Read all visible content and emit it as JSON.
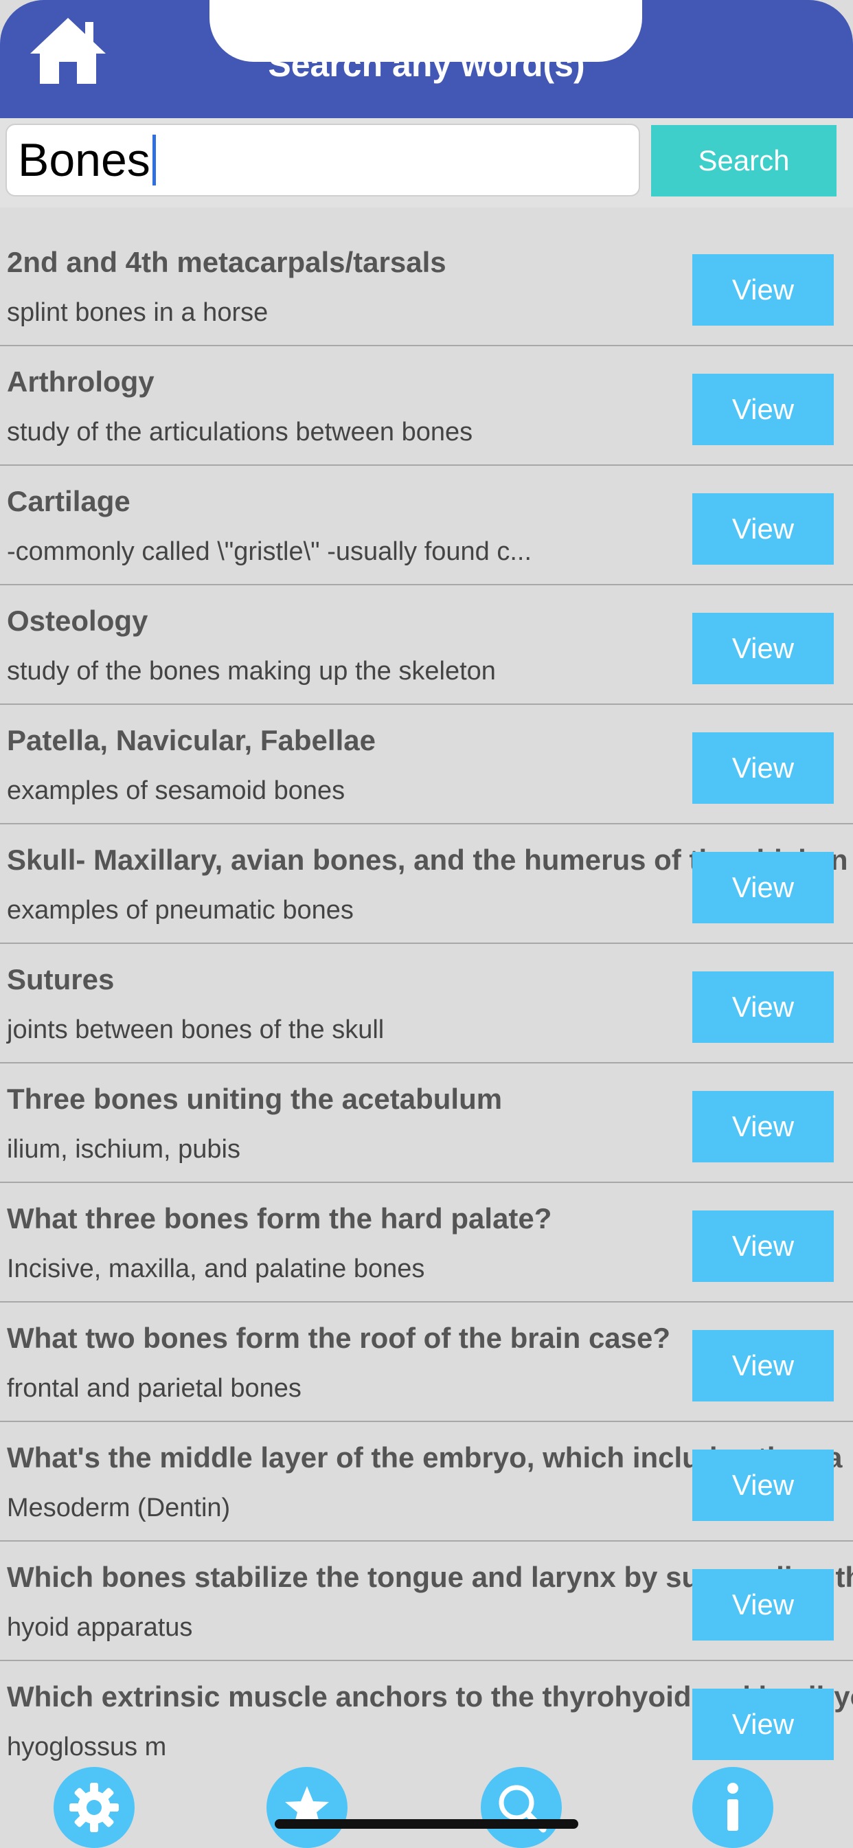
{
  "header": {
    "title": "Search any word(s)"
  },
  "search": {
    "value": "Bones",
    "button_label": "Search"
  },
  "results": [
    {
      "term": "2nd and 4th metacarpals/tarsals",
      "definition": "splint bones in a horse",
      "button": "View"
    },
    {
      "term": "Arthrology",
      "definition": "study of the articulations between bones",
      "button": "View"
    },
    {
      "term": "Cartilage",
      "definition": "-commonly called \\\"gristle\\\" -usually found c...",
      "button": "View"
    },
    {
      "term": "Osteology",
      "definition": "study of the bones making up the skeleton",
      "button": "View"
    },
    {
      "term": "Patella, Navicular, Fabellae",
      "definition": "examples of sesamoid bones",
      "button": "View"
    },
    {
      "term": "Skull- Maxillary, avian bones, and the humerus of the chicken",
      "definition": "examples of pneumatic bones",
      "button": "View"
    },
    {
      "term": "Sutures",
      "definition": "joints between bones of the skull",
      "button": "View"
    },
    {
      "term": "Three bones uniting the acetabulum",
      "definition": "ilium, ischium, pubis",
      "button": "View"
    },
    {
      "term": "What three bones form the hard palate?",
      "definition": "Incisive, maxilla, and palatine bones",
      "button": "View"
    },
    {
      "term": "What two bones form the roof of the brain case?",
      "definition": "frontal and parietal bones",
      "button": "View"
    },
    {
      "term": "What's the middle layer of the embryo, which includes the ga",
      "definition": "Mesoderm (Dentin)",
      "button": "View"
    },
    {
      "term": "Which bones stabilize the tongue and larynx by suspending th",
      "definition": "hyoid apparatus",
      "button": "View"
    },
    {
      "term": "Which extrinsic muscle anchors to the thyrohyoid and basihyo",
      "definition": "hyoglossus m",
      "button": "View"
    }
  ],
  "tabs": [
    {
      "name": "settings",
      "icon": "gear-icon"
    },
    {
      "name": "favorites",
      "icon": "star-icon"
    },
    {
      "name": "search",
      "icon": "search-icon"
    },
    {
      "name": "info",
      "icon": "info-icon"
    }
  ],
  "colors": {
    "header": "#4358b4",
    "search_button": "#3ecfcb",
    "view_button": "#4fc5f7",
    "background": "#dcdcdc"
  }
}
